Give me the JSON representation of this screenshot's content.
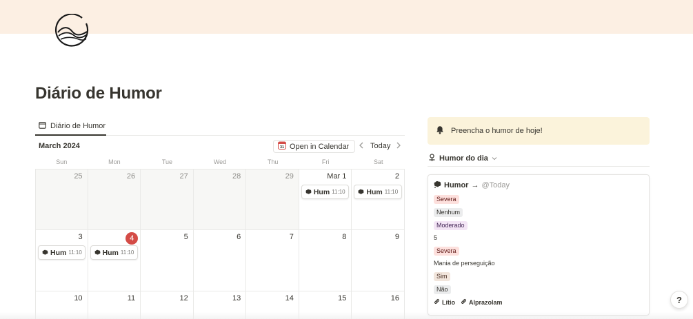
{
  "page": {
    "title": "Diário de Humor",
    "cover_color": "#fcefe3",
    "icon": "wave-circle-logo"
  },
  "database": {
    "tab_label": "Diário de Humor",
    "tab_icon": "calendar-view-icon",
    "month_label": "March 2024",
    "open_in_calendar_label": "Open in Calendar",
    "today_label": "Today",
    "weekdays": [
      "Sun",
      "Mon",
      "Tue",
      "Wed",
      "Thu",
      "Fri",
      "Sat"
    ],
    "weeks": [
      [
        {
          "label": "25",
          "muted": true
        },
        {
          "label": "26",
          "muted": true
        },
        {
          "label": "27",
          "muted": true
        },
        {
          "label": "28",
          "muted": true
        },
        {
          "label": "29",
          "muted": true
        },
        {
          "label": "Mar 1",
          "muted": false,
          "event": {
            "title": "Hum",
            "time": "11:10"
          }
        },
        {
          "label": "2",
          "muted": false,
          "event": {
            "title": "Hum",
            "time": "11:10"
          }
        }
      ],
      [
        {
          "label": "3",
          "muted": false,
          "event": {
            "title": "Hum",
            "time": "11:10"
          }
        },
        {
          "label": "4",
          "muted": false,
          "today": true,
          "event": {
            "title": "Hum",
            "time": "11:10"
          }
        },
        {
          "label": "5",
          "muted": false
        },
        {
          "label": "6",
          "muted": false
        },
        {
          "label": "7",
          "muted": false
        },
        {
          "label": "8",
          "muted": false
        },
        {
          "label": "9",
          "muted": false
        }
      ],
      [
        {
          "label": "10",
          "muted": false
        },
        {
          "label": "11",
          "muted": false
        },
        {
          "label": "12",
          "muted": false
        },
        {
          "label": "13",
          "muted": false
        },
        {
          "label": "14",
          "muted": false
        },
        {
          "label": "15",
          "muted": false
        },
        {
          "label": "16",
          "muted": false
        }
      ]
    ],
    "today_color": "#d44c47"
  },
  "callout": {
    "icon": "bell-icon",
    "text": "Preencha o humor de hoje!",
    "background": "#fbf3db"
  },
  "humor_dia": {
    "icon": "person-pin-icon",
    "title": "Humor do dia",
    "card": {
      "title": "Humor",
      "arrow": "→",
      "mention": "@Today",
      "properties": [
        {
          "kind": "tag",
          "color": "red",
          "text": "Severa"
        },
        {
          "kind": "tag",
          "color": "gray",
          "text": "Nenhum"
        },
        {
          "kind": "tag",
          "color": "purple",
          "text": "Moderado"
        },
        {
          "kind": "plain",
          "text": "5"
        },
        {
          "kind": "tag",
          "color": "red",
          "text": "Severa"
        },
        {
          "kind": "plain",
          "text": "Mania de perseguição"
        },
        {
          "kind": "tag",
          "color": "brown",
          "text": "Sim"
        },
        {
          "kind": "tag",
          "color": "gray",
          "text": "Não"
        }
      ],
      "medications": [
        "Lítio",
        "Alprazolam"
      ]
    }
  },
  "help_label": "?"
}
